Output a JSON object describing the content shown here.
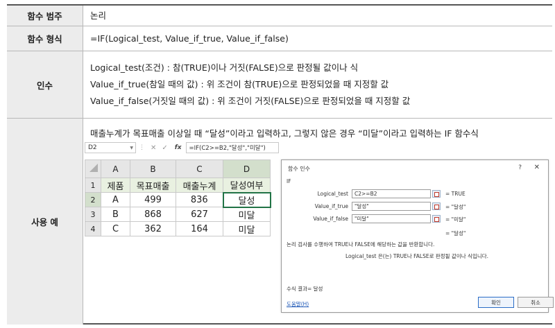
{
  "rows": {
    "category": {
      "label": "함수 범주",
      "value": "논리"
    },
    "format": {
      "label": "함수 형식",
      "value": "=IF(Logical_test, Value_if_true, Value_if_false)"
    },
    "args": {
      "label": "인수",
      "lines": [
        "Logical_test(조건) : 참(TRUE)이나 거짓(FALSE)으로 판정될 값이나 식",
        "Value_if_true(참일 때의 값) : 위 조건이 참(TRUE)으로 판정되었을 때 지정할 값",
        "Value_if_false(거짓일 때의 값) : 위 조건이 거짓(FALSE)으로 판정되었을 때 지정할 값"
      ]
    },
    "example": {
      "label": "사용 예",
      "description": "매출누계가 목표매출 이상일 때 “달성”이라고 입력하고, 그렇지 않은 경우 “미달”이라고 입력하는 IF 함수식"
    }
  },
  "excel": {
    "name_box": "D2",
    "formula": "=IF(C2>=B2,\"달성\",\"미달\")",
    "columns": [
      "A",
      "B",
      "C",
      "D"
    ],
    "row_numbers": [
      "1",
      "2",
      "3",
      "4"
    ],
    "header": [
      "제품",
      "목표매출",
      "매출누계",
      "달성여부"
    ],
    "data": [
      [
        "A",
        "499",
        "836",
        "달성"
      ],
      [
        "B",
        "868",
        "627",
        "미달"
      ],
      [
        "C",
        "362",
        "164",
        "미달"
      ]
    ]
  },
  "dialog": {
    "title": "함수 인수",
    "help_glyph": "?",
    "close_glyph": "✕",
    "function_name": "IF",
    "args": [
      {
        "label": "Logical_test",
        "value": "C2>=B2",
        "result": "=  TRUE"
      },
      {
        "label": "Value_if_true",
        "value": "\"달성\"",
        "result": "=  \"달성\""
      },
      {
        "label": "Value_if_false",
        "value": "\"미달\"",
        "result": "=  \"미달\""
      }
    ],
    "result_line": "=  \"달성\"",
    "description": "논리 검사를 수행하여 TRUE나 FALSE에 해당하는 값을 반환합니다.",
    "arg_description": "Logical_test  은(는) TRUE나 FALSE로 판정될 값이나 식입니다.",
    "formula_result": "수식 결과=  달성",
    "help_link": "도움말(H)",
    "ok": "확인",
    "cancel": "취소"
  }
}
